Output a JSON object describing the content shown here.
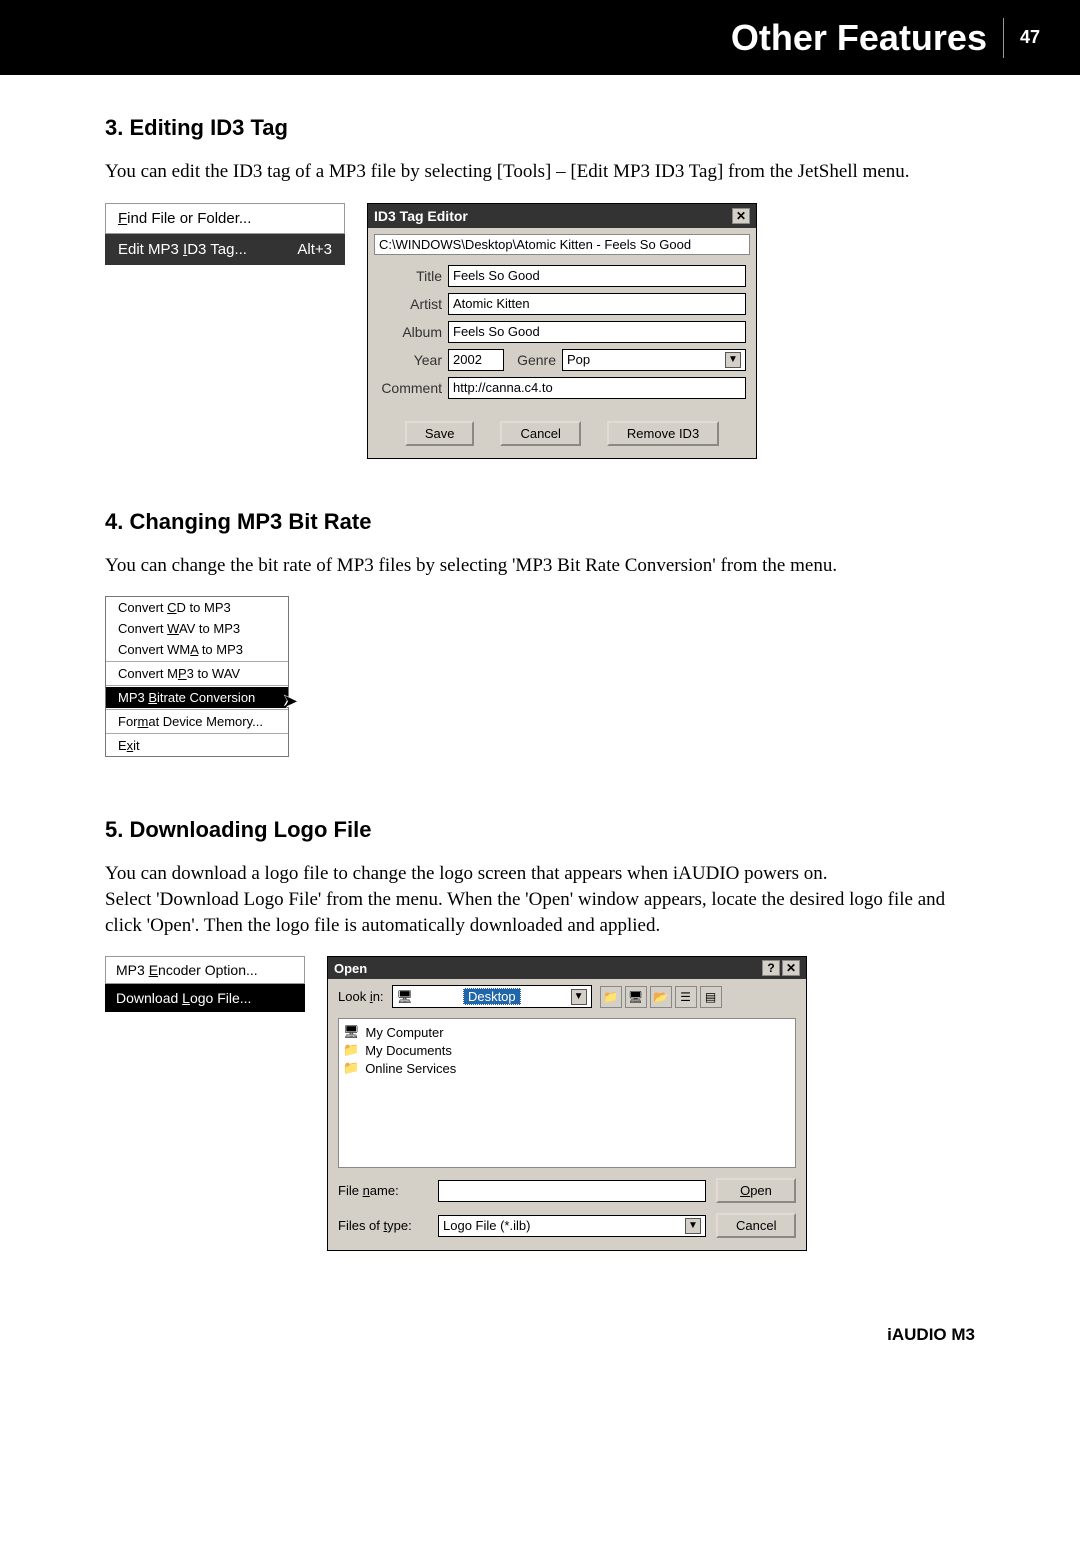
{
  "header": {
    "title": "Other Features",
    "page_num": "47"
  },
  "section3": {
    "heading": "3. Editing ID3 Tag",
    "body": "You can edit the ID3 tag of a MP3 file by selecting [Tools] – [Edit MP3 ID3 Tag] from the JetShell menu.",
    "menu": {
      "find": "Find File or Folder...",
      "edit": "Edit MP3 ID3 Tag...",
      "edit_shortcut": "Alt+3"
    },
    "dialog": {
      "title": "ID3 Tag Editor",
      "path": "C:\\WINDOWS\\Desktop\\Atomic Kitten - Feels So Good",
      "labels": {
        "title": "Title",
        "artist": "Artist",
        "album": "Album",
        "year": "Year",
        "genre": "Genre",
        "comment": "Comment"
      },
      "values": {
        "title": "Feels So Good",
        "artist": "Atomic Kitten",
        "album": "Feels So Good",
        "year": "2002",
        "genre": "Pop",
        "comment": "http://canna.c4.to"
      },
      "buttons": {
        "save": "Save",
        "cancel": "Cancel",
        "remove": "Remove ID3"
      }
    }
  },
  "section4": {
    "heading": "4. Changing MP3 Bit Rate",
    "body": "You can change the bit rate of MP3 files by selecting 'MP3 Bit Rate Conversion' from the menu.",
    "menu": {
      "items": [
        "Convert CD to MP3",
        "Convert WAV to MP3",
        "Convert WMA to MP3",
        "Convert MP3 to WAV",
        "MP3 Bitrate Conversion",
        "Format Device Memory...",
        "Exit"
      ],
      "selected_index": 4
    }
  },
  "section5": {
    "heading": "5. Downloading Logo File",
    "body": "You can download a logo file to change the logo screen that appears when iAUDIO powers on.\nSelect 'Download Logo File' from the menu. When the 'Open' window appears, locate the desired logo file and click 'Open'. Then the logo file is automatically downloaded and applied.",
    "menu": {
      "encoder": "MP3 Encoder Option...",
      "download": "Download Logo File..."
    },
    "open_dialog": {
      "title": "Open",
      "look_in_label": "Look in:",
      "look_in_value": "Desktop",
      "list": [
        "My Computer",
        "My Documents",
        "Online Services"
      ],
      "file_name_label": "File name:",
      "file_name_value": "",
      "file_type_label": "Files of type:",
      "file_type_value": "Logo File (*.ilb)",
      "open_btn": "Open",
      "cancel_btn": "Cancel"
    }
  },
  "footer": {
    "product": "iAUDIO M3"
  }
}
